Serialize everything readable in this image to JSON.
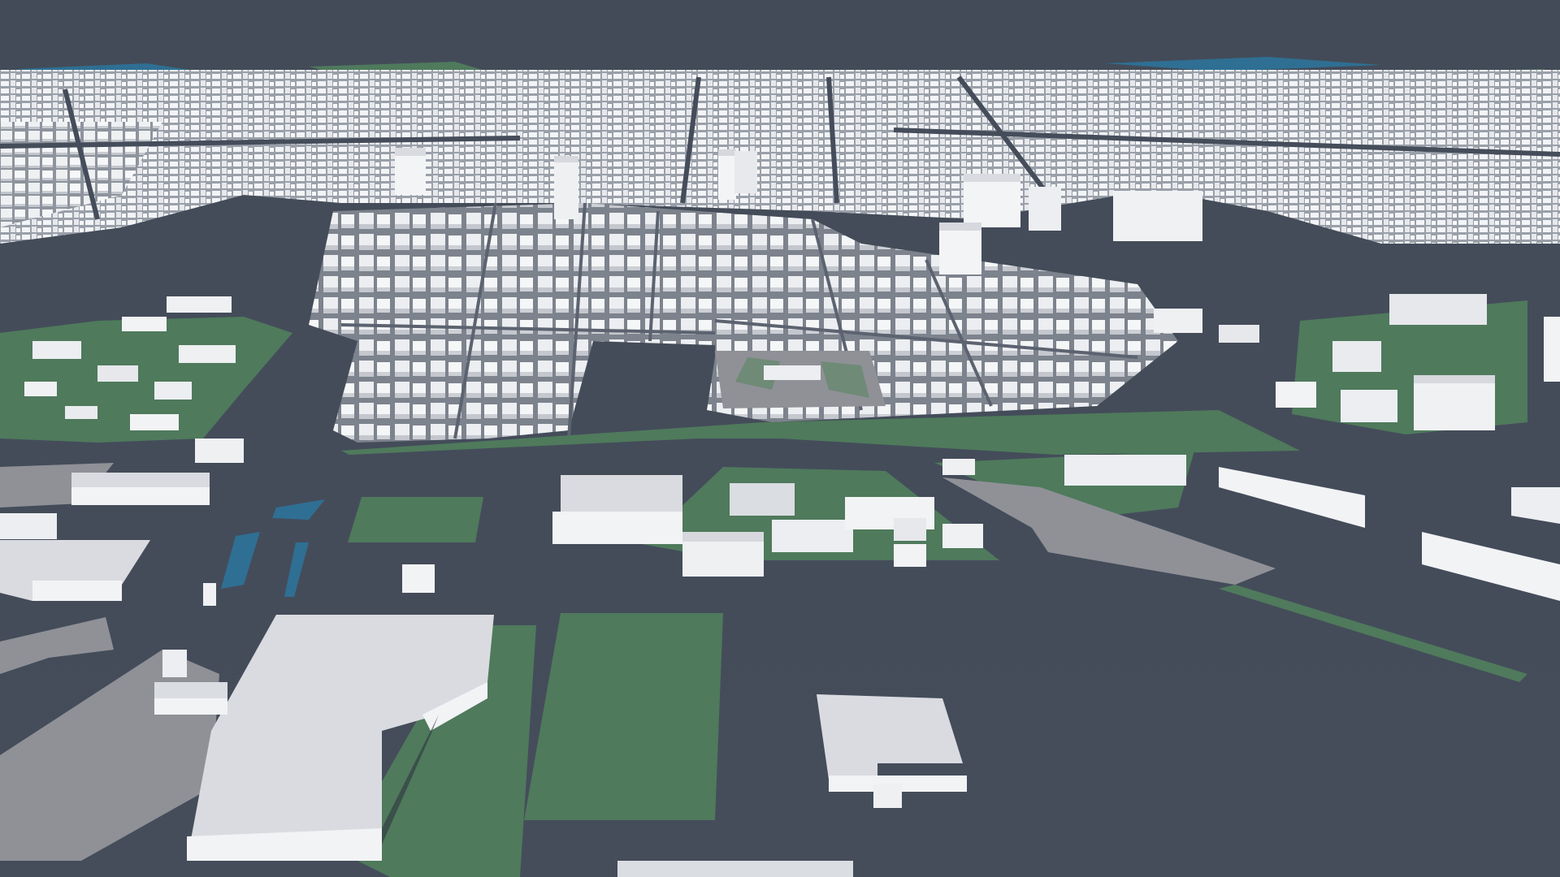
{
  "scene": {
    "type": "3d-city-map",
    "view": "oblique-aerial",
    "colors": {
      "ground": "#454d5b",
      "ground_far": "#3f4754",
      "park": "#4f7a5c",
      "water": "#2f6f93",
      "paved_lot": "#8f9197",
      "building_top": "#d9dbe0",
      "building_wall_light": "#f2f3f5",
      "building_wall_dark": "#b6b9c0",
      "shadow": "#2e343d"
    }
  }
}
